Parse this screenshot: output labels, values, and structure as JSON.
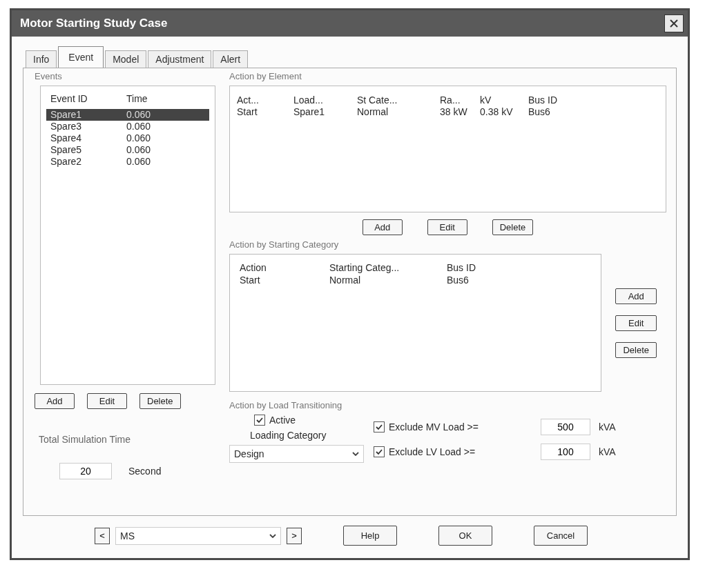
{
  "window": {
    "title": "Motor Starting Study Case"
  },
  "tabs": [
    {
      "label": "Info",
      "selected": false
    },
    {
      "label": "Event",
      "selected": true
    },
    {
      "label": "Model",
      "selected": false
    },
    {
      "label": "Adjustment",
      "selected": false
    },
    {
      "label": "Alert",
      "selected": false
    }
  ],
  "events": {
    "label": "Events",
    "columns": [
      "Event ID",
      "Time"
    ],
    "rows": [
      {
        "cells": [
          "Spare1",
          "0.060"
        ],
        "selected": true
      },
      {
        "cells": [
          "Spare3",
          "0.060"
        ],
        "selected": false
      },
      {
        "cells": [
          "Spare4",
          "0.060"
        ],
        "selected": false
      },
      {
        "cells": [
          "Spare5",
          "0.060"
        ],
        "selected": false
      },
      {
        "cells": [
          "Spare2",
          "0.060"
        ],
        "selected": false
      }
    ],
    "buttons": [
      "Add",
      "Edit",
      "Delete"
    ]
  },
  "simulation_time": {
    "label": "Total Simulation Time",
    "value": "20",
    "unit": "Second"
  },
  "action_by_element": {
    "label": "Action by Element",
    "columns": [
      "Act...",
      "Load...",
      "St Cate...",
      "Ra...",
      "kV",
      "Bus ID"
    ],
    "rows": [
      [
        "Start",
        "Spare1",
        "Normal",
        "38 kW",
        "0.38 kV",
        "Bus6"
      ]
    ],
    "buttons": [
      "Add",
      "Edit",
      "Delete"
    ]
  },
  "action_by_category": {
    "label": "Action by Starting Category",
    "columns": [
      "Action",
      "Starting Categ...",
      "Bus ID"
    ],
    "rows": [
      [
        "Start",
        "Normal",
        "Bus6"
      ]
    ],
    "buttons": [
      "Add",
      "Edit",
      "Delete"
    ]
  },
  "load_transitioning": {
    "label": "Action by Load Transitioning",
    "active": {
      "label": "Active",
      "checked": true
    },
    "loading_category": {
      "label": "Loading Category",
      "value": "Design"
    },
    "exclusions": [
      {
        "label": "Exclude MV Load >=",
        "checked": true,
        "value": "500",
        "unit": "kVA"
      },
      {
        "label": "Exclude LV Load >=",
        "checked": true,
        "value": "100",
        "unit": "kVA"
      }
    ]
  },
  "footer": {
    "prev": "<",
    "case": "MS",
    "next": ">",
    "buttons": [
      "Help",
      "OK",
      "Cancel"
    ]
  }
}
